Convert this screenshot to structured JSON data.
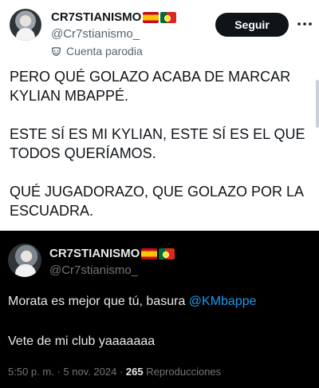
{
  "top_tweet": {
    "author": {
      "name": "CR7STIANISMO",
      "handle": "@Cr7stianismo_",
      "label": "Cuenta parodia",
      "flags": [
        "spain-flag-icon",
        "portugal-flag-icon"
      ]
    },
    "follow_label": "Seguir",
    "paragraphs": [
      "PERO QUÉ GOLAZO ACABA DE MARCAR KYLIAN MBAPPÉ.",
      "ESTE SÍ ES MI KYLIAN, ESTE SÍ ES EL QUE TODOS QUERÍAMOS.",
      "QUÉ JUGADORAZO, QUE GOLAZO POR LA ESCUADRA."
    ]
  },
  "bottom_tweet": {
    "author": {
      "name": "CR7STIANISMO",
      "handle": "@Cr7stianismo_",
      "flags": [
        "spain-flag-icon",
        "portugal-flag-icon"
      ]
    },
    "line1_text": "Morata es mejor que tú, basura ",
    "line1_mention": "@KMbappe",
    "line2": "Vete de mi club yaaaaaaa",
    "time": "5:50 p. m.",
    "separator": " · ",
    "date": "5 nov. 2024",
    "views_count": "265",
    "views_label": " Reproducciones"
  },
  "colors": {
    "accent": "#1d9bf0",
    "dark_bg": "#000000",
    "follow_bg": "#0f1419"
  }
}
